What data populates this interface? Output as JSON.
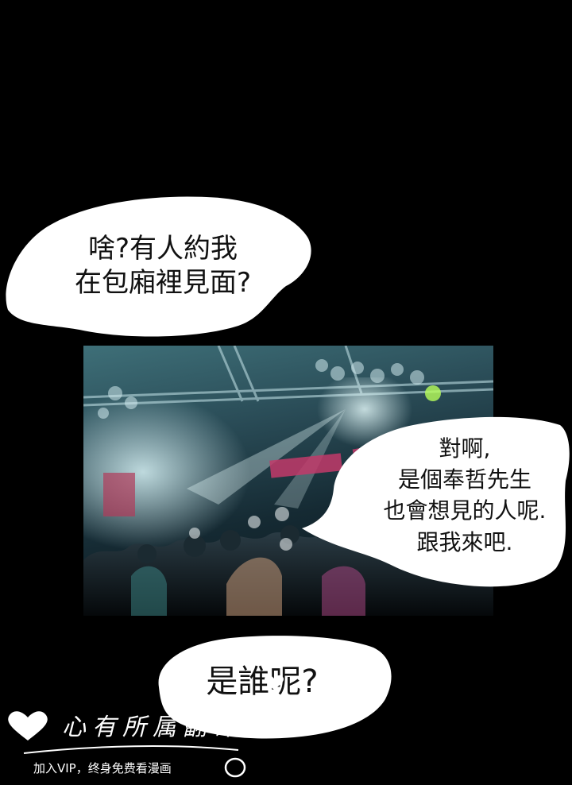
{
  "bubbles": {
    "top": {
      "line1": "啥?有人約我",
      "line2": "在包廂裡見面?"
    },
    "middle": {
      "line1": "對啊,",
      "line2": "是個奉哲先生",
      "line3": "也會想見的人呢.",
      "line4": "跟我來吧."
    },
    "bottom": {
      "line1": "是誰呢?"
    }
  },
  "watermark": {
    "title": "心有所属翻译团队",
    "subtitle": "加入VIP，终身免费看漫画"
  },
  "colors": {
    "background": "#000000",
    "bubble_fill": "#ffffff",
    "bubble_text": "#111111",
    "panel_teal": "#3e6f78",
    "panel_dark": "#0b1217",
    "panel_magenta": "#c23a6a"
  },
  "icons": {
    "watermark_heart": "heart-icon",
    "watermark_ring": "ring-icon"
  }
}
